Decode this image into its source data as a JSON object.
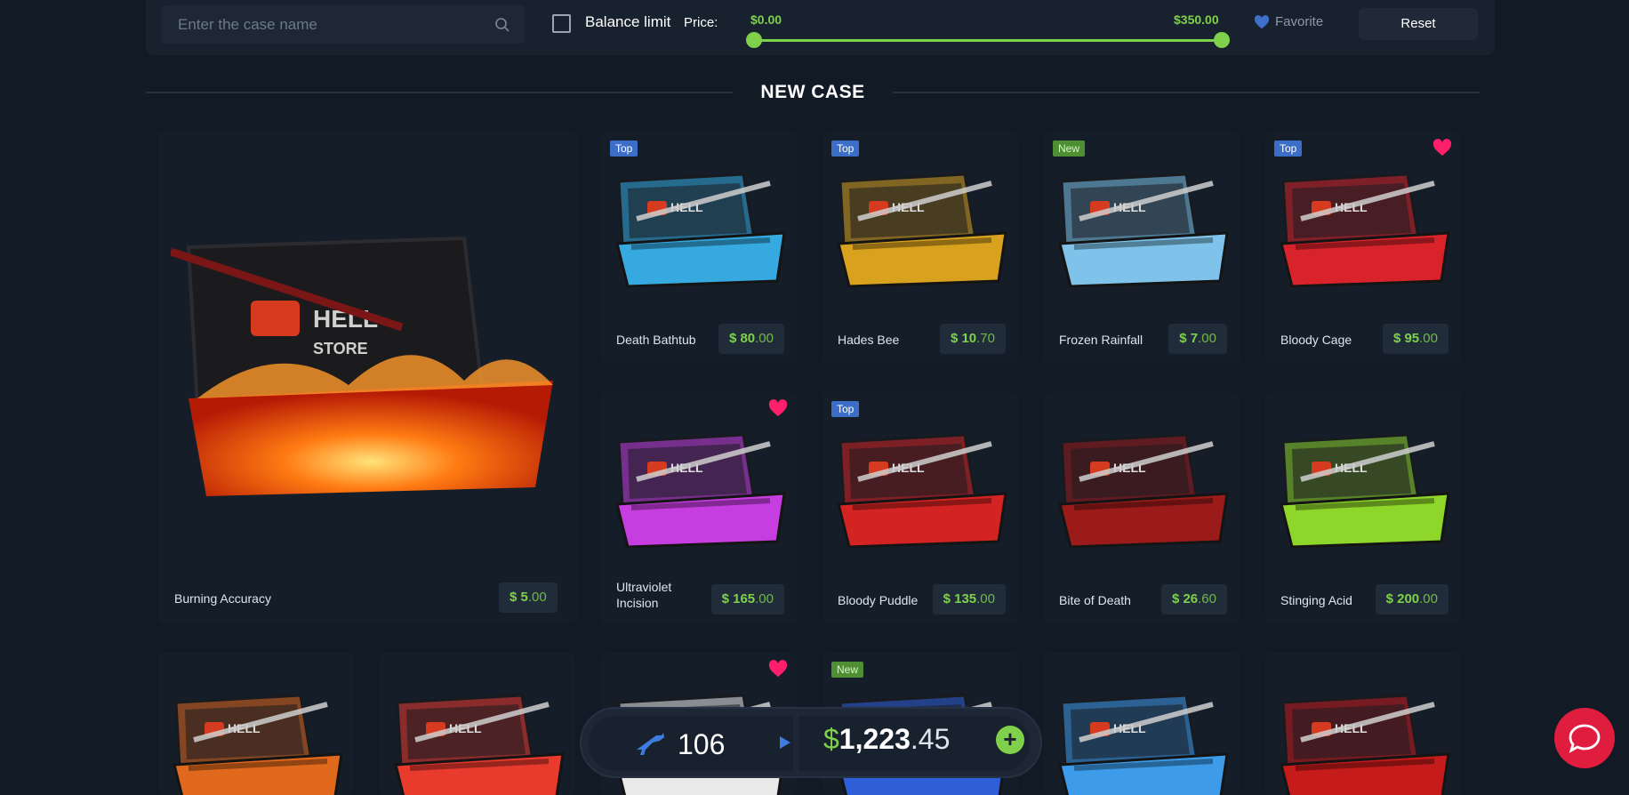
{
  "filters": {
    "search_placeholder": "Enter the case name",
    "balance_limit_label": "Balance limit",
    "price_label": "Price:",
    "price_min": "$0.00",
    "price_max": "$350.00",
    "favorite_label": "Favorite",
    "reset_label": "Reset"
  },
  "section_title": "NEW CASE",
  "featured": {
    "name": "Burning Accuracy",
    "price_main": "$ 5",
    "price_cents": ".00"
  },
  "cases": [
    {
      "name": "Death Bathtub",
      "price_main": "$ 80",
      "price_cents": ".00",
      "badge": "Top",
      "favorite": false,
      "theme": "#35a9e0"
    },
    {
      "name": "Hades Bee",
      "price_main": "$ 10",
      "price_cents": ".70",
      "badge": "Top",
      "favorite": false,
      "theme": "#d9a21e"
    },
    {
      "name": "Frozen Rainfall",
      "price_main": "$ 7",
      "price_cents": ".00",
      "badge": "New",
      "favorite": false,
      "theme": "#7fc3ea"
    },
    {
      "name": "Bloody Cage",
      "price_main": "$ 95",
      "price_cents": ".00",
      "badge": "Top",
      "favorite": true,
      "theme": "#d8232a"
    },
    {
      "name": "Ultraviolet Incision",
      "price_main": "$ 165",
      "price_cents": ".00",
      "badge": "",
      "favorite": true,
      "theme": "#c63ee0"
    },
    {
      "name": "Bloody Puddle",
      "price_main": "$ 135",
      "price_cents": ".00",
      "badge": "Top",
      "favorite": false,
      "theme": "#d42323"
    },
    {
      "name": "Bite of Death",
      "price_main": "$ 26",
      "price_cents": ".60",
      "badge": "",
      "favorite": false,
      "theme": "#9b1b1b"
    },
    {
      "name": "Stinging Acid",
      "price_main": "$ 200",
      "price_cents": ".00",
      "badge": "",
      "favorite": false,
      "theme": "#8fd62a"
    }
  ],
  "bottom_row": [
    {
      "badge": "",
      "favorite": false,
      "theme": "#e0691d"
    },
    {
      "badge": "",
      "favorite": false,
      "theme": "#e83a2d"
    },
    {
      "badge": "",
      "favorite": true,
      "theme": "#e9e9e9"
    },
    {
      "badge": "New",
      "favorite": false,
      "theme": "#2f5fd8"
    },
    {
      "badge": "",
      "favorite": false,
      "theme": "#3d9bea"
    },
    {
      "badge": "",
      "favorite": false,
      "theme": "#c51b1b"
    }
  ],
  "footer": {
    "count": "106",
    "balance_symbol": "$",
    "balance_main": "1,223",
    "balance_cents": ".45",
    "add_icon": "+"
  }
}
